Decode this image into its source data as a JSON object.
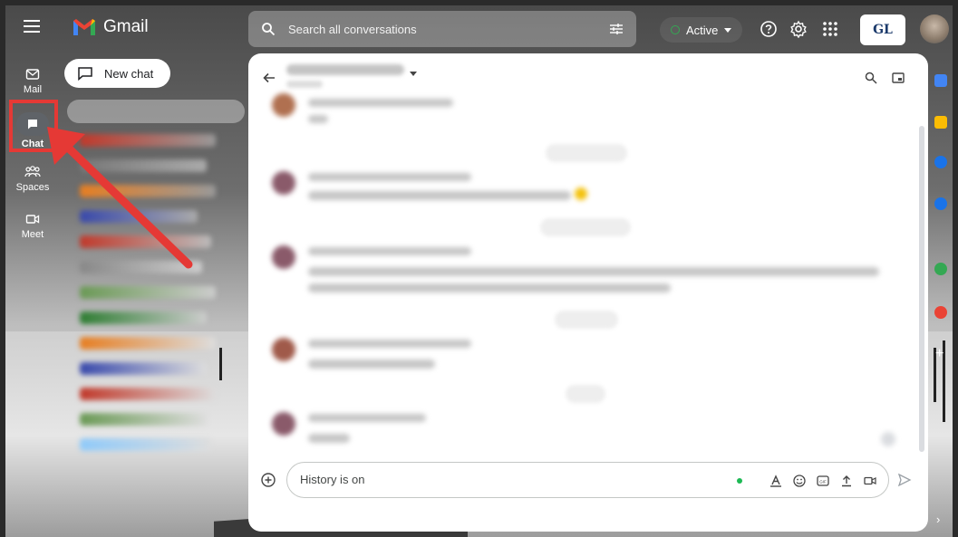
{
  "app": {
    "name": "Gmail"
  },
  "search": {
    "placeholder": "Search all conversations"
  },
  "status": {
    "label": "Active"
  },
  "account": {
    "org_logo_text": "GL"
  },
  "rail": {
    "items": [
      {
        "label": "Mail",
        "icon": "mail-icon"
      },
      {
        "label": "Chat",
        "icon": "chat-icon"
      },
      {
        "label": "Spaces",
        "icon": "spaces-icon"
      },
      {
        "label": "Meet",
        "icon": "meet-icon"
      }
    ]
  },
  "new_chat": {
    "label": "New chat"
  },
  "compose": {
    "placeholder": "History is on"
  },
  "colors": {
    "accent_red": "#e53935",
    "status_green": "#34a853",
    "panel_bg": "#ffffff"
  },
  "right_rail": {
    "icons": [
      "calendar-icon",
      "keep-icon",
      "tasks-icon",
      "contacts-icon",
      "addon-green-icon",
      "addon-red-icon"
    ]
  }
}
